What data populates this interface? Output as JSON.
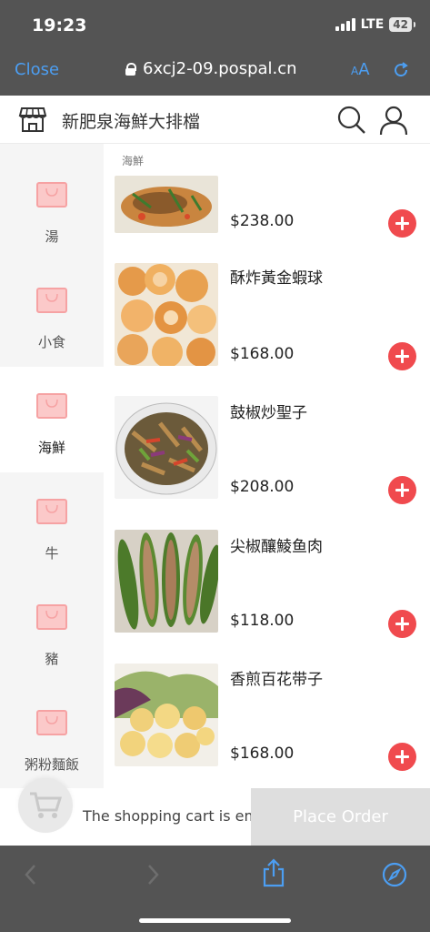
{
  "status_bar": {
    "time": "19:23",
    "network": "LTE",
    "battery": "42"
  },
  "browser": {
    "close_label": "Close",
    "url": "6xcj2-09.pospal.cn",
    "aa_small": "A",
    "aa_large": "A"
  },
  "store": {
    "name": "新肥泉海鮮大排檔"
  },
  "categories": [
    {
      "label": "湯"
    },
    {
      "label": "小食"
    },
    {
      "label": "海鮮"
    },
    {
      "label": "牛"
    },
    {
      "label": "豬"
    },
    {
      "label": "粥粉麵飯"
    }
  ],
  "active_category": "海鮮",
  "product_section_label": "海鮮",
  "products": [
    {
      "name": "",
      "price": "$238.00"
    },
    {
      "name": "酥炸黃金蝦球",
      "price": "$168.00"
    },
    {
      "name": "鼓椒炒聖子",
      "price": "$208.00"
    },
    {
      "name": "尖椒釀鯪鱼肉",
      "price": "$118.00"
    },
    {
      "name": "香煎百花带子",
      "price": "$168.00"
    }
  ],
  "cart": {
    "empty_text": "The shopping cart is empty",
    "order_label": "Place Order"
  },
  "colors": {
    "accent": "#4c9ef2",
    "add_button": "#f04a4e",
    "chrome": "#545454",
    "bag": "#f6a2a3"
  },
  "icons": {
    "store": "storefront-icon",
    "search": "search-icon",
    "user": "user-icon",
    "category": "shopping-bag-icon",
    "add": "plus-icon",
    "cart": "cart-icon",
    "back": "chevron-left-icon",
    "forward": "chevron-right-icon",
    "share": "share-icon",
    "compass": "compass-icon",
    "lock": "lock-icon",
    "reload": "reload-icon"
  }
}
